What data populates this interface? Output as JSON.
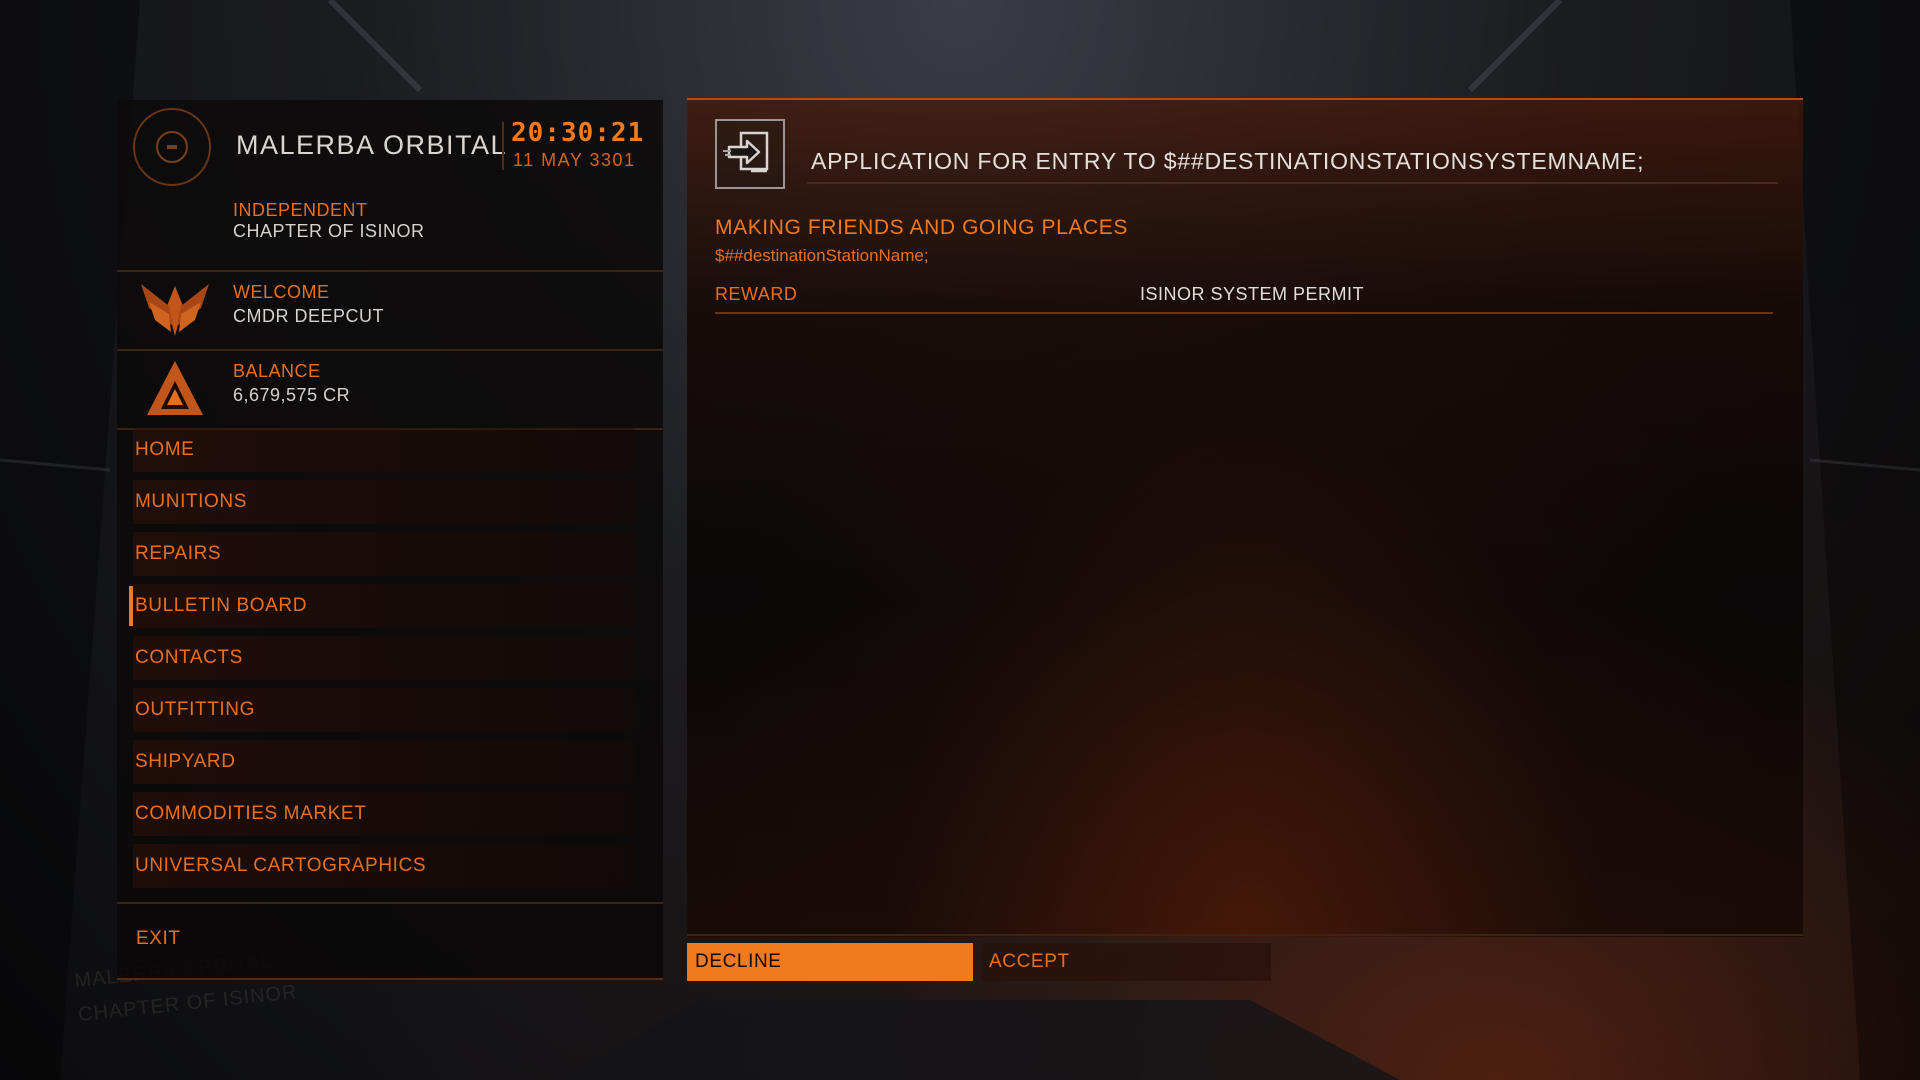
{
  "station": {
    "name": "MALERBA ORBITAL",
    "time": "20:30:21",
    "date": "11 MAY 3301",
    "allegiance": "INDEPENDENT",
    "faction": "CHAPTER OF ISINOR"
  },
  "commander": {
    "welcome_label": "WELCOME",
    "name": "CMDR DEEPCUT"
  },
  "balance": {
    "label": "BALANCE",
    "value": "6,679,575 CR"
  },
  "menu": {
    "items": [
      {
        "label": "HOME"
      },
      {
        "label": "MUNITIONS"
      },
      {
        "label": "REPAIRS"
      },
      {
        "label": "BULLETIN BOARD",
        "active": true
      },
      {
        "label": "CONTACTS"
      },
      {
        "label": "OUTFITTING"
      },
      {
        "label": "SHIPYARD"
      },
      {
        "label": "COMMODITIES MARKET"
      },
      {
        "label": "UNIVERSAL CARTOGRAPHICS"
      }
    ],
    "exit_label": "EXIT"
  },
  "mission": {
    "title": "APPLICATION FOR ENTRY TO $##DESTINATIONSTATIONSYSTEMNAME;",
    "subtitle": "MAKING FRIENDS AND GOING PLACES",
    "description": "$##destinationStationName;",
    "reward_label": "REWARD",
    "reward_value": "ISINOR SYSTEM PERMIT"
  },
  "buttons": {
    "decline": "DECLINE",
    "accept": "ACCEPT"
  },
  "background": {
    "ghost_lines": [
      "MALERBA ORBITAL",
      "CHAPTER OF ISINOR"
    ]
  },
  "colors": {
    "accent": "#f07a1e",
    "text": "#d6d2ce"
  }
}
